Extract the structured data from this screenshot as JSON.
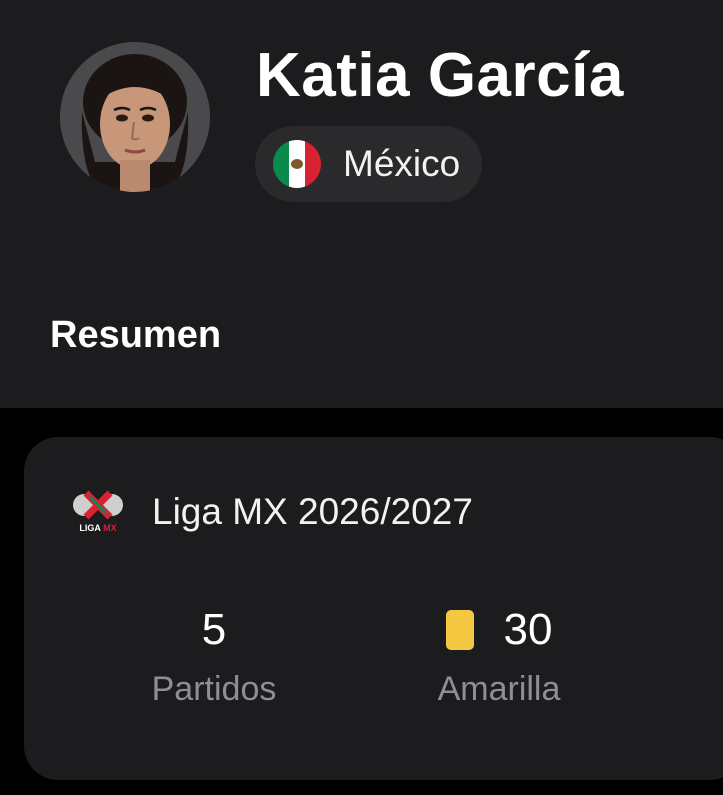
{
  "player": {
    "name": "Katia García",
    "country": "México"
  },
  "section": {
    "title": "Resumen"
  },
  "stats_card": {
    "league_name": "Liga MX 2026/2027",
    "league_logo_text": "LIGA MX",
    "matches": {
      "value": "5",
      "label": "Partidos"
    },
    "yellow_cards": {
      "value": "30",
      "label": "Amarilla",
      "icon": "yellow-card-icon",
      "color": "#f5c842"
    }
  },
  "colors": {
    "background": "#000000",
    "surface": "#1c1c1e",
    "chip": "#2a2a2c",
    "secondary_text": "#8e8e93"
  }
}
